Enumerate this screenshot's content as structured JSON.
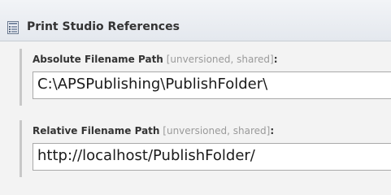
{
  "header": {
    "title": "Print Studio References",
    "icon": "document-list-icon"
  },
  "fields": [
    {
      "label": "Absolute Filename Path",
      "tag": "[unversioned, shared]",
      "colon": ":",
      "value": "C:\\APSPublishing\\PublishFolder\\"
    },
    {
      "label": "Relative Filename Path",
      "tag": "[unversioned, shared]",
      "colon": ":",
      "value": "http://localhost/PublishFolder/"
    }
  ]
}
